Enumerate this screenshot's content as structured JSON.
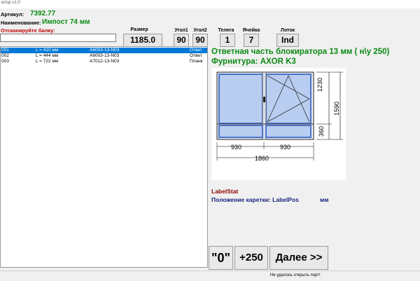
{
  "window": {
    "title": "ютор v1.0"
  },
  "article": {
    "label": "Артикул:",
    "value": "7392.77"
  },
  "name": {
    "label": "Наименование:",
    "value": "Импост 74 мм"
  },
  "scan": {
    "prompt": "Отсканируйте балку:",
    "value": ""
  },
  "fields": {
    "size": {
      "label": "Размер",
      "value": "1185.0"
    },
    "angle1": {
      "label": "Угол1",
      "value": "90"
    },
    "angle2": {
      "label": "Угол2",
      "value": "90"
    },
    "cart": {
      "label": "Телега",
      "value": "1"
    },
    "cell": {
      "label": "Ячейка",
      "value": "7"
    },
    "tray": {
      "label": "Лоток",
      "value": "Ind"
    }
  },
  "list": [
    {
      "id": "001",
      "length": "L = 410 мм",
      "code": "A6003-13-N03",
      "type": "Ответ",
      "selected": true
    },
    {
      "id": "002",
      "length": "L = 444 мм",
      "code": "A6003-13-N03",
      "type": "Ответ",
      "selected": false
    },
    {
      "id": "003",
      "length": "L = 722 мм",
      "code": "A7012-13-N03",
      "type": "Планк",
      "selected": false
    }
  ],
  "detail": {
    "title": "Ответная часть блокиратора 13 мм  ( н\\у 250)",
    "hardware": "Фурнитура: AXOR K3",
    "label_stat": "LabelStat",
    "carriage_label": "Положение каретки: LabelPos",
    "carriage_unit": "мм"
  },
  "drawing": {
    "dims": {
      "w_left": "930",
      "w_right": "930",
      "total_w": "1860",
      "h_top": "1230",
      "h_bottom": "360",
      "total_h": "1590"
    },
    "frame_color": "#4a73c8",
    "glass_color": "#b8cdf0"
  },
  "buttons": {
    "zero": "\"0\"",
    "plus": "+250",
    "next": "Далее >>"
  },
  "status": {
    "message": "Не удалось открыть порт!"
  }
}
